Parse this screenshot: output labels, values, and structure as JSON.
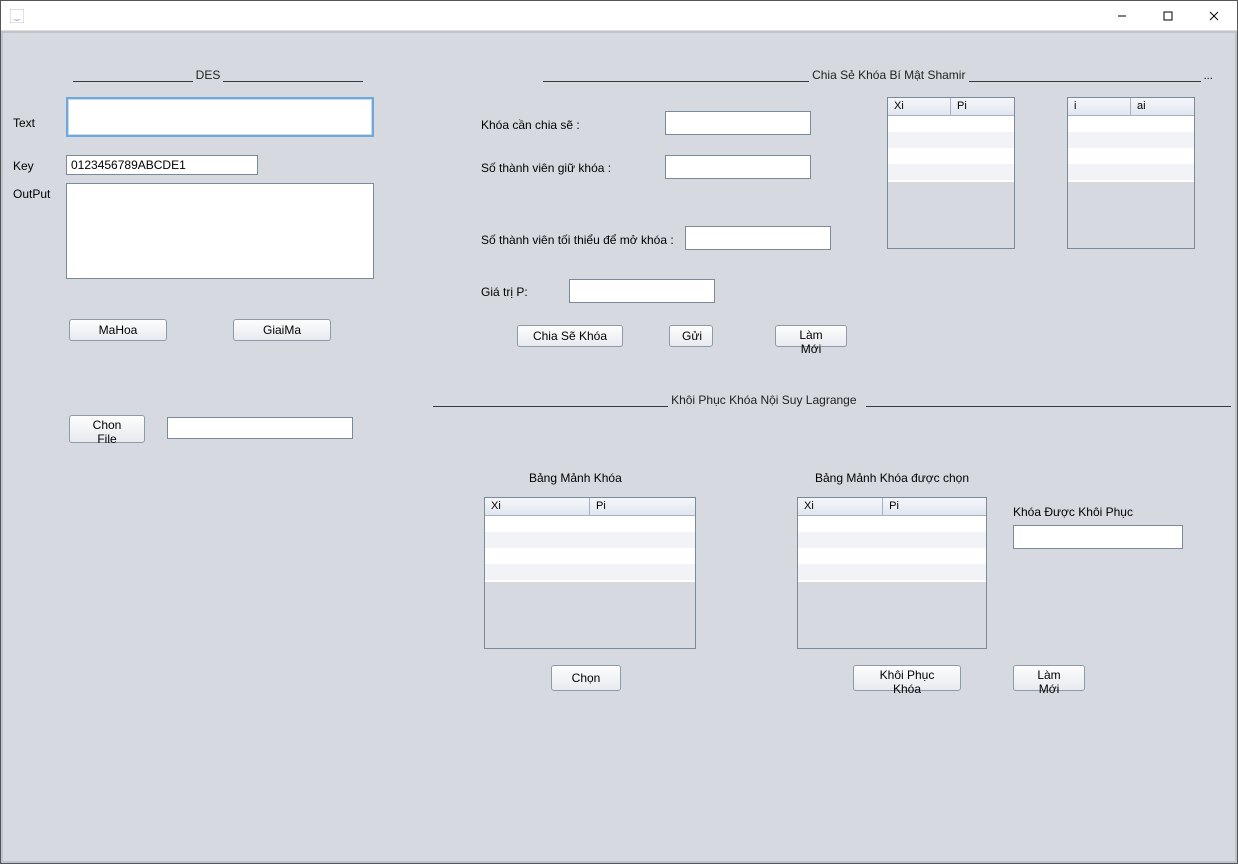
{
  "window": {
    "title": ""
  },
  "des": {
    "section_title": "DES",
    "text_label": "Text",
    "text_value": "",
    "key_label": "Key",
    "key_value": "0123456789ABCDE1",
    "output_label": "OutPut",
    "output_value": "",
    "mahoa_label": "MaHoa",
    "giaima_label": "GiaiMa",
    "chonfile_label": "Chon File",
    "file_value": ""
  },
  "shamir": {
    "section_title": "Chia Sẻ Khóa Bí Mật Shamir",
    "key_share_label": "Khóa cần chia sẽ :",
    "key_share_value": "",
    "members_label": "Số thành viên giữ khóa :",
    "members_value": "",
    "min_members_label": "Số thành viên tối thiểu để mở khóa :",
    "min_members_value": "",
    "p_label": "Giá trị P:",
    "p_value": "",
    "share_btn": "Chia Sẽ Khóa",
    "send_btn": "Gửi",
    "reset_btn": "Làm Mới",
    "table1_cols": {
      "c0": "Xi",
      "c1": "Pi"
    },
    "table2_cols": {
      "c0": "i",
      "c1": "ai"
    }
  },
  "lagrange": {
    "section_title": "Khôi Phục Khóa Nội Suy Lagrange",
    "table_left_title": "Bảng Mảnh Khóa",
    "table_right_title": "Bảng Mảnh Khóa được chọn",
    "recovered_label": "Khóa Được Khôi Phục",
    "recovered_value": "",
    "cols": {
      "c0": "Xi",
      "c1": "Pi"
    },
    "chon_btn": "Chọn",
    "recover_btn": "Khôi Phục Khóa",
    "reset_btn": "Làm Mới"
  }
}
